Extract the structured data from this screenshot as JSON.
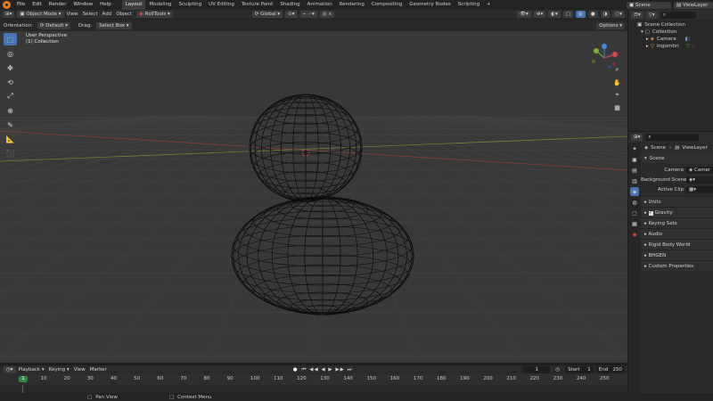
{
  "app": {
    "menu": [
      "File",
      "Edit",
      "Render",
      "Window",
      "Help"
    ],
    "workspaces": [
      "Layout",
      "Modeling",
      "Sculpting",
      "UV Editing",
      "Texture Paint",
      "Shading",
      "Animation",
      "Rendering",
      "Compositing",
      "Geometry Nodes",
      "Scripting"
    ],
    "active_workspace": "Layout",
    "scene_name": "Scene",
    "view_layer": "ViewLayer"
  },
  "viewport_header": {
    "mode": "Object Mode",
    "menus": [
      "View",
      "Select",
      "Add",
      "Object"
    ],
    "extra": "RollTools",
    "transform_orientation": "Global"
  },
  "tool_header": {
    "orientation_label": "Orientation:",
    "orientation_value": "Default",
    "drag_label": "Drag:",
    "drag_value": "Select Box",
    "options_label": "Options"
  },
  "viewport": {
    "perspective_label": "User Perspective",
    "collection_label": "(1) Collection"
  },
  "toolbar": [
    "select-box",
    "cursor",
    "move",
    "rotate",
    "scale",
    "transform",
    "annotate",
    "measure",
    "add-cube"
  ],
  "timeline": {
    "menus": [
      "Playback",
      "Keying",
      "View",
      "Marker"
    ],
    "current_frame": "1",
    "start_label": "Start",
    "start_value": "1",
    "end_label": "End",
    "end_value": "250",
    "ticks": [
      "1",
      "10",
      "20",
      "30",
      "40",
      "50",
      "60",
      "70",
      "80",
      "90",
      "100",
      "110",
      "120",
      "130",
      "140",
      "150",
      "160",
      "170",
      "180",
      "190",
      "200",
      "210",
      "220",
      "230",
      "240",
      "250"
    ]
  },
  "statusbar": {
    "pan_view": "Pan View",
    "context_menu": "Context Menu"
  },
  "outliner": {
    "root": "Scene Collection",
    "collection": "Collection",
    "items": [
      "Camera",
      "Ingombri"
    ]
  },
  "properties": {
    "breadcrumb_scene": "Scene",
    "breadcrumb_layer": "ViewLayer",
    "scene_panel": "Scene",
    "camera_label": "Camera",
    "camera_value": "Camer",
    "background_scene_label": "Background Scene",
    "active_clip_label": "Active Clip",
    "panels": [
      "Units",
      "Gravity",
      "Keying Sets",
      "Audio",
      "Rigid Body World",
      "BHGEN",
      "Custom Properties"
    ]
  },
  "colors": {
    "accent": "#4772b3",
    "active_frame": "#2f8a3f",
    "viewport_bg": "#393939",
    "x_axis": "#8b3d3d",
    "y_axis": "#6a8a2e"
  }
}
